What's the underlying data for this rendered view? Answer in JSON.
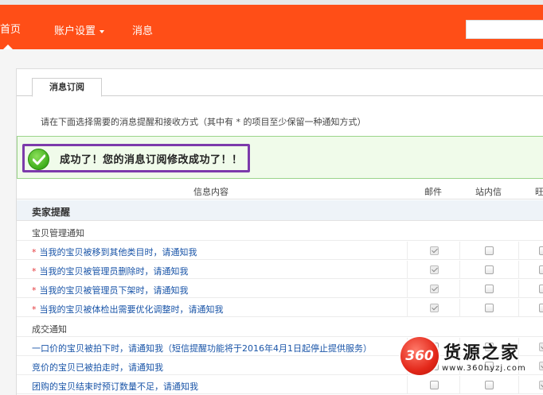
{
  "nav": {
    "home": "首页",
    "account": "账户设置",
    "message": "消息"
  },
  "tab": {
    "label": "消息订阅"
  },
  "instruction": "请在下面选择需要的消息提醒和接收方式（其中有 * 的项目至少保留一种通知方式）",
  "success": {
    "message": "成功了！您的消息订阅修改成功了！！",
    "highlight_color": "#7c3aab"
  },
  "table": {
    "headers": {
      "content": "信息内容",
      "email": "邮件",
      "site": "站内信",
      "other": "旺"
    },
    "section_title": "卖家提醒",
    "group1": {
      "label": "宝贝管理通知",
      "items": [
        {
          "text": "当我的宝贝被移到其他类目时，请通知我",
          "star": "*",
          "email": true,
          "site": false
        },
        {
          "text": "当我的宝贝被管理员删除时，请通知我",
          "star": "*",
          "email": true,
          "site": false
        },
        {
          "text": "当我的宝贝被管理员下架时，请通知我",
          "star": "*",
          "email": true,
          "site": false
        },
        {
          "text": "当我的宝贝被体检出需要优化调整时，请通知我",
          "star": "*",
          "email": true,
          "site": false
        }
      ]
    },
    "group2": {
      "label": "成交通知",
      "items": [
        {
          "text": "一口价的宝贝被拍下时，请通知我（短信提醒功能将于2016年4月1日起停止提供服务）"
        },
        {
          "text": "竞价的宝贝已被拍走时，请通知我"
        },
        {
          "text": "团购的宝贝结束时预订数量不足，请通知我"
        }
      ]
    }
  },
  "watermark": {
    "logo": "360",
    "title": "货源之家",
    "url": "www.360hyzj.com"
  },
  "colors": {
    "nav_bg": "#ff4e17",
    "success_bg": "#f0fbea",
    "link": "#1a55a8"
  }
}
